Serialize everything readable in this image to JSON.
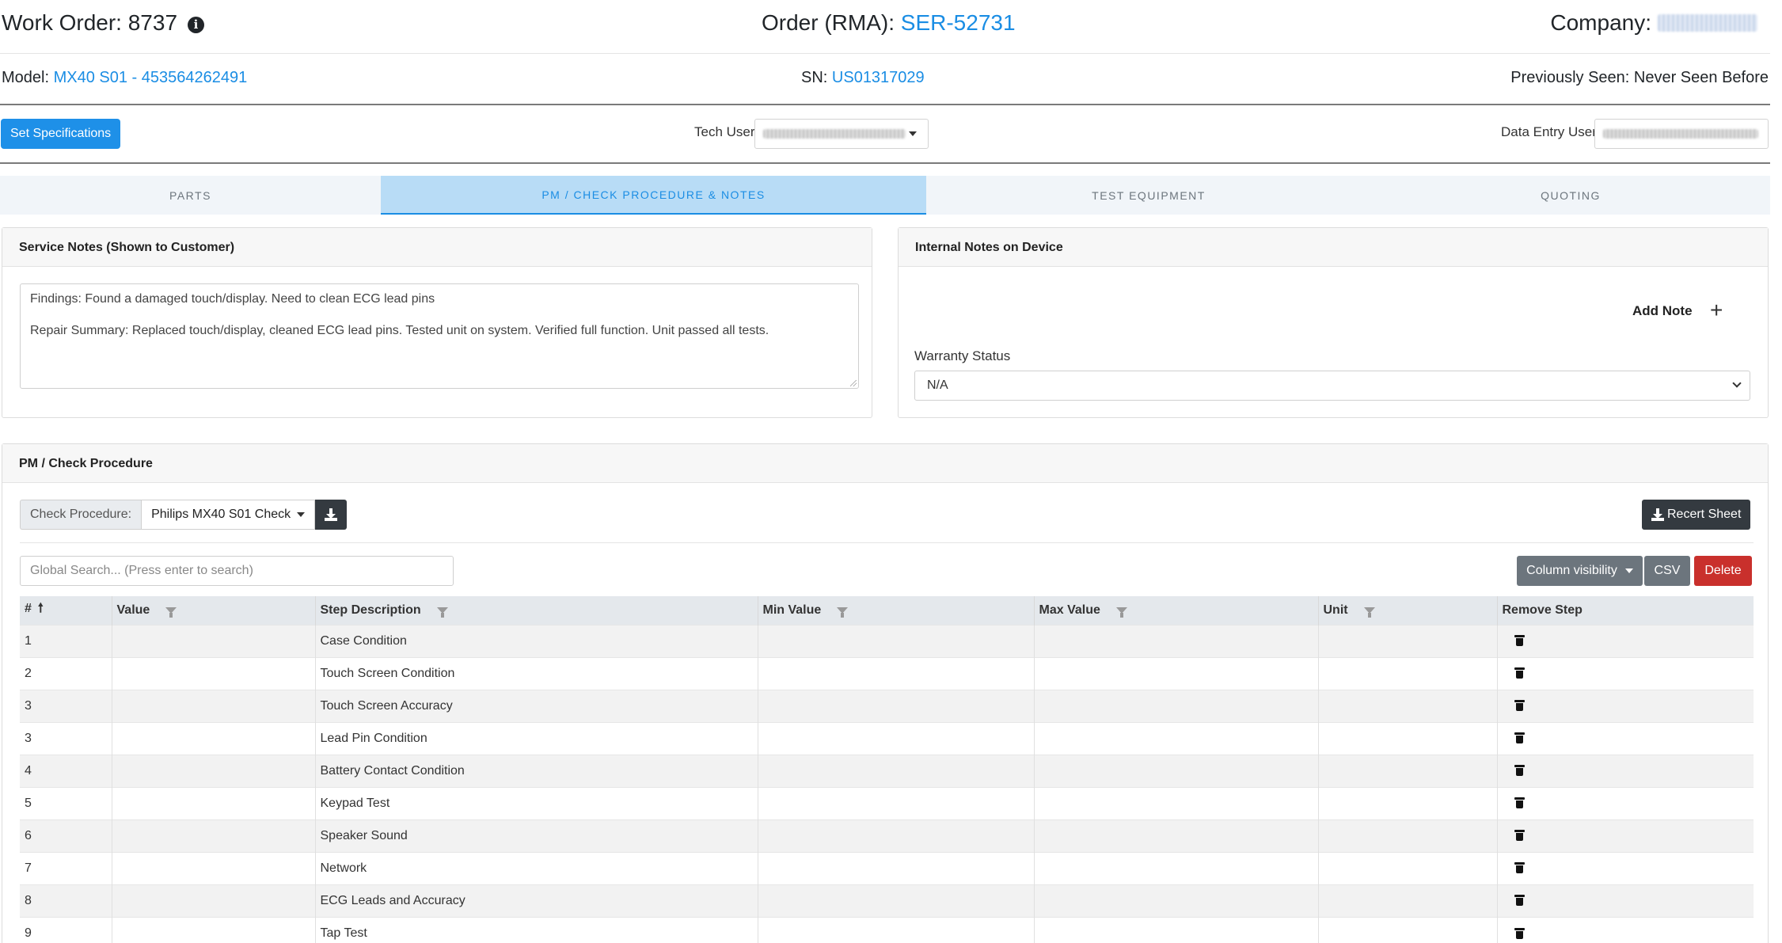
{
  "header": {
    "work_order_label": "Work Order: 8737",
    "order_label": "Order (RMA):",
    "order_value": "SER-52731",
    "company_label": "Company:",
    "model_label": "Model:",
    "model_value": "MX40 S01 - 453564262491",
    "sn_label": "SN:",
    "sn_value": "US01317029",
    "previously_seen": "Previously Seen: Never Seen Before"
  },
  "toolbar": {
    "set_specs_label": "Set Specifications",
    "tech_user_label": "Tech User",
    "data_entry_user_label": "Data Entry User"
  },
  "tabs": [
    {
      "label": "PARTS",
      "active": false
    },
    {
      "label": "PM / CHECK PROCEDURE & NOTES",
      "active": true
    },
    {
      "label": "TEST EQUIPMENT",
      "active": false
    },
    {
      "label": "QUOTING",
      "active": false
    }
  ],
  "service_notes": {
    "title": "Service Notes (Shown to Customer)",
    "findings": "Findings: Found a damaged touch/display. Need to clean ECG lead pins",
    "repair_summary": "Repair Summary: Replaced touch/display, cleaned ECG lead pins. Tested unit on system. Verified full function. Unit passed all tests."
  },
  "internal_notes": {
    "title": "Internal Notes on Device",
    "add_note_label": "Add Note",
    "warranty_label": "Warranty Status",
    "warranty_value": "N/A"
  },
  "pm_check": {
    "title": "PM / Check Procedure",
    "check_procedure_label": "Check Procedure:",
    "check_procedure_value": "Philips MX40 S01 Check",
    "recert_label": "Recert Sheet",
    "search_placeholder": "Global Search... (Press enter to search)",
    "column_visibility_label": "Column visibility",
    "csv_label": "CSV",
    "delete_label": "Delete",
    "columns": [
      "#",
      "Value",
      "Step Description",
      "Min Value",
      "Max Value",
      "Unit",
      "Remove Step"
    ],
    "rows": [
      {
        "num": "1",
        "value": "",
        "desc": "Case Condition",
        "min": "",
        "max": "",
        "unit": ""
      },
      {
        "num": "2",
        "value": "",
        "desc": "Touch Screen Condition",
        "min": "",
        "max": "",
        "unit": ""
      },
      {
        "num": "3",
        "value": "",
        "desc": "Touch Screen Accuracy",
        "min": "",
        "max": "",
        "unit": ""
      },
      {
        "num": "3",
        "value": "",
        "desc": "Lead Pin Condition",
        "min": "",
        "max": "",
        "unit": ""
      },
      {
        "num": "4",
        "value": "",
        "desc": "Battery Contact Condition",
        "min": "",
        "max": "",
        "unit": ""
      },
      {
        "num": "5",
        "value": "",
        "desc": "Keypad Test",
        "min": "",
        "max": "",
        "unit": ""
      },
      {
        "num": "6",
        "value": "",
        "desc": "Speaker Sound",
        "min": "",
        "max": "",
        "unit": ""
      },
      {
        "num": "7",
        "value": "",
        "desc": "Network",
        "min": "",
        "max": "",
        "unit": ""
      },
      {
        "num": "8",
        "value": "",
        "desc": "ECG Leads and Accuracy",
        "min": "",
        "max": "",
        "unit": ""
      },
      {
        "num": "9",
        "value": "",
        "desc": "Tap Test",
        "min": "",
        "max": "",
        "unit": ""
      }
    ]
  },
  "colors": {
    "link": "#1a8de4",
    "primary": "#1e90e8",
    "active_tab_bg": "#b8dcf6",
    "dark_button": "#343a40",
    "danger": "#c9302c"
  },
  "icons": {
    "info": "info-icon",
    "download": "download-icon",
    "plus": "plus-icon",
    "trash": "trash-icon",
    "filter": "filter-icon",
    "sort": "sort-up-icon"
  }
}
